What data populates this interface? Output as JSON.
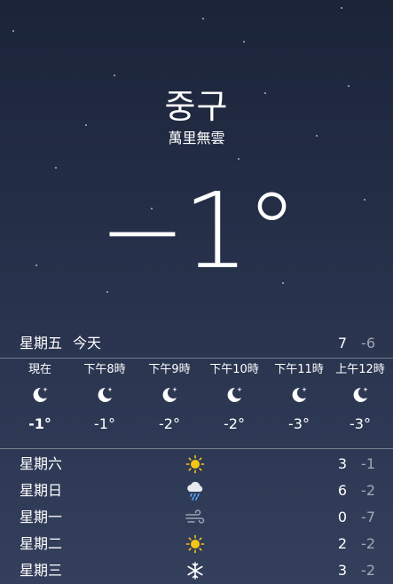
{
  "location": {
    "city": "중구",
    "condition": "萬里無雲"
  },
  "current": {
    "temperature": "−1°"
  },
  "today": {
    "day": "星期五",
    "label": "今天",
    "high": "7",
    "low": "-6"
  },
  "hourly": [
    {
      "time": "現在",
      "icon": "moon-star-icon",
      "temp": "-1°"
    },
    {
      "time": "下午8時",
      "icon": "moon-star-icon",
      "temp": "-1°"
    },
    {
      "time": "下午9時",
      "icon": "moon-star-icon",
      "temp": "-2°"
    },
    {
      "time": "下午10時",
      "icon": "moon-star-icon",
      "temp": "-2°"
    },
    {
      "time": "下午11時",
      "icon": "moon-star-icon",
      "temp": "-3°"
    },
    {
      "time": "上午12時",
      "icon": "moon-star-icon",
      "temp": "-3°"
    }
  ],
  "daily": [
    {
      "day": "星期六",
      "icon": "sun-icon",
      "high": "3",
      "low": "-1"
    },
    {
      "day": "星期日",
      "icon": "rain-cloud-icon",
      "high": "6",
      "low": "-2"
    },
    {
      "day": "星期一",
      "icon": "wind-icon",
      "high": "0",
      "low": "-7"
    },
    {
      "day": "星期二",
      "icon": "sun-icon",
      "high": "2",
      "low": "-2"
    },
    {
      "day": "星期三",
      "icon": "snowflake-icon",
      "high": "3",
      "low": "-2"
    }
  ],
  "colors": {
    "sun": "#f5c518",
    "background_top": "#1b2438",
    "background_bottom": "#333f5b"
  }
}
